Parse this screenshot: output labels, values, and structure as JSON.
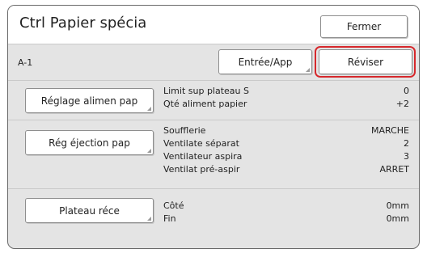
{
  "header": {
    "title": "Ctrl Papier spécia",
    "close_label": "Fermer"
  },
  "mode": {
    "current": "A-1",
    "entry_label": "Entrée/App",
    "revise_label": "Réviser"
  },
  "colors": {
    "highlight": "#d6282c",
    "panel_bg": "#e4e4e4"
  },
  "sections": [
    {
      "button_label": "Réglage alimen pap",
      "items": [
        {
          "label": "Limit sup plateau S",
          "value": "0"
        },
        {
          "label": "Qté aliment papier",
          "value": "+2"
        }
      ]
    },
    {
      "button_label": "Rég éjection pap",
      "items": [
        {
          "label": "Soufflerie",
          "value": "MARCHE"
        },
        {
          "label": "Ventilate séparat",
          "value": "2"
        },
        {
          "label": "Ventilateur aspira",
          "value": "3"
        },
        {
          "label": "Ventilat pré-aspir",
          "value": "ARRET"
        }
      ]
    },
    {
      "button_label": "Plateau réce",
      "items": [
        {
          "label": "Côté",
          "value": "0mm"
        },
        {
          "label": "Fin",
          "value": "0mm"
        }
      ]
    }
  ]
}
